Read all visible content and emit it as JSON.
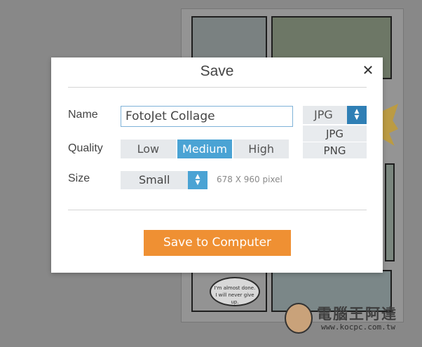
{
  "dialog": {
    "title": "Save",
    "close_icon": "close-icon",
    "name_label": "Name",
    "name_value": "FotoJet Collage",
    "quality_label": "Quality",
    "quality_options": [
      "Low",
      "Medium",
      "High"
    ],
    "quality_selected": "Medium",
    "size_label": "Size",
    "size_value": "Small",
    "size_info": "678 X 960 pixel",
    "format_value": "JPG",
    "format_options": [
      "JPG",
      "PNG"
    ],
    "save_button": "Save to Computer"
  },
  "background": {
    "speech_bubble": "I'm almost done.\nI will never give up.",
    "watermark_title": "電腦王阿達",
    "watermark_url": "www.kocpc.com.tw"
  },
  "colors": {
    "accent": "#4aa3d4",
    "save_button": "#ef9033",
    "overlay": "#8e8e8e"
  }
}
